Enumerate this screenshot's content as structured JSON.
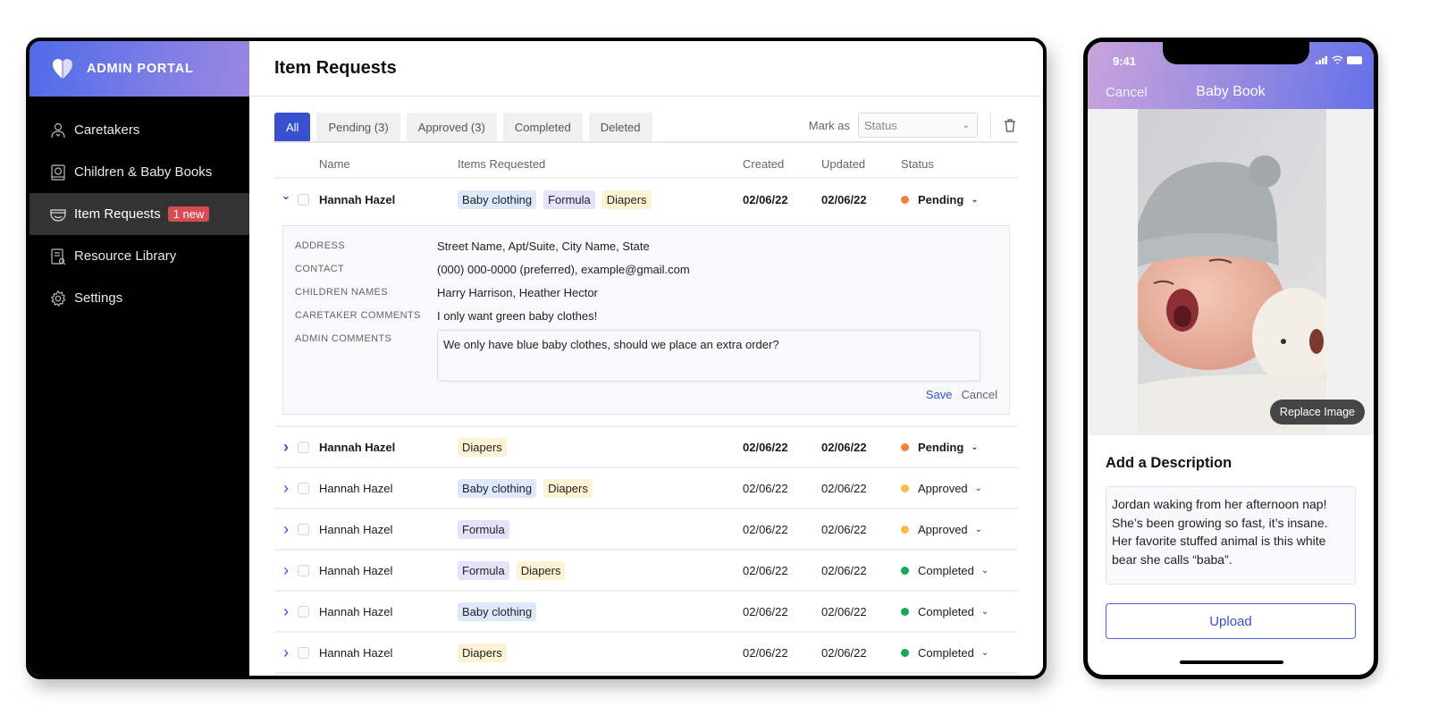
{
  "admin": {
    "brand": "ADMIN PORTAL",
    "nav": [
      {
        "label": "Caretakers",
        "icon": "caretaker-icon"
      },
      {
        "label": "Children & Baby Books",
        "icon": "baby-book-icon"
      },
      {
        "label": "Item Requests",
        "icon": "diaper-icon",
        "badge": "1 new",
        "active": true
      },
      {
        "label": "Resource Library",
        "icon": "resource-library-icon"
      },
      {
        "label": "Settings",
        "icon": "gear-icon"
      }
    ],
    "page_title": "Item Requests",
    "tabs": [
      {
        "label": "All",
        "active": true
      },
      {
        "label": "Pending (3)"
      },
      {
        "label": "Approved (3)"
      },
      {
        "label": "Completed"
      },
      {
        "label": "Deleted"
      }
    ],
    "mark_as_label": "Mark as",
    "status_placeholder": "Status",
    "columns": {
      "name": "Name",
      "items": "Items Requested",
      "created": "Created",
      "updated": "Updated",
      "status": "Status"
    },
    "status_colors": {
      "Pending": "#f5813a",
      "Approved": "#fbbc45",
      "Completed": "#14a85a"
    },
    "tag_colors": {
      "Baby clothing": "#dde9fb",
      "Formula": "#e7e2fb",
      "Diapers": "#fbf3d3"
    },
    "rows": [
      {
        "name": "Hannah Hazel",
        "items": [
          "Baby clothing",
          "Formula",
          "Diapers"
        ],
        "created": "02/06/22",
        "updated": "02/06/22",
        "status": "Pending",
        "bold": true,
        "expanded": true
      },
      {
        "name": "Hannah Hazel",
        "items": [
          "Diapers"
        ],
        "created": "02/06/22",
        "updated": "02/06/22",
        "status": "Pending",
        "bold": true
      },
      {
        "name": "Hannah Hazel",
        "items": [
          "Baby clothing",
          "Diapers"
        ],
        "created": "02/06/22",
        "updated": "02/06/22",
        "status": "Approved"
      },
      {
        "name": "Hannah Hazel",
        "items": [
          "Formula"
        ],
        "created": "02/06/22",
        "updated": "02/06/22",
        "status": "Approved"
      },
      {
        "name": "Hannah Hazel",
        "items": [
          "Formula",
          "Diapers"
        ],
        "created": "02/06/22",
        "updated": "02/06/22",
        "status": "Completed"
      },
      {
        "name": "Hannah Hazel",
        "items": [
          "Baby clothing"
        ],
        "created": "02/06/22",
        "updated": "02/06/22",
        "status": "Completed"
      },
      {
        "name": "Hannah Hazel",
        "items": [
          "Diapers"
        ],
        "created": "02/06/22",
        "updated": "02/06/22",
        "status": "Completed"
      }
    ],
    "detail": {
      "fields": [
        {
          "label": "ADDRESS",
          "value": "Street Name, Apt/Suite, City Name, State"
        },
        {
          "label": "CONTACT",
          "value": "(000) 000-0000 (preferred), example@gmail.com"
        },
        {
          "label": "CHILDREN NAMES",
          "value": "Harry Harrison, Heather Hector"
        },
        {
          "label": "CARETAKER COMMENTS",
          "value": "I only want green baby clothes!"
        }
      ],
      "admin_label": "ADMIN COMMENTS",
      "admin_comment": "We only have blue baby clothes, should we place an extra order?",
      "save": "Save",
      "cancel": "Cancel"
    }
  },
  "phone": {
    "time": "9:41",
    "cancel": "Cancel",
    "title": "Baby Book",
    "replace_image": "Replace Image",
    "heading": "Add a Description",
    "description": "Jordan waking from her afternoon nap! She’s been growing so fast, it’s insane. Her favorite stuffed animal is this white bear she calls “baba”.",
    "upload": "Upload"
  }
}
